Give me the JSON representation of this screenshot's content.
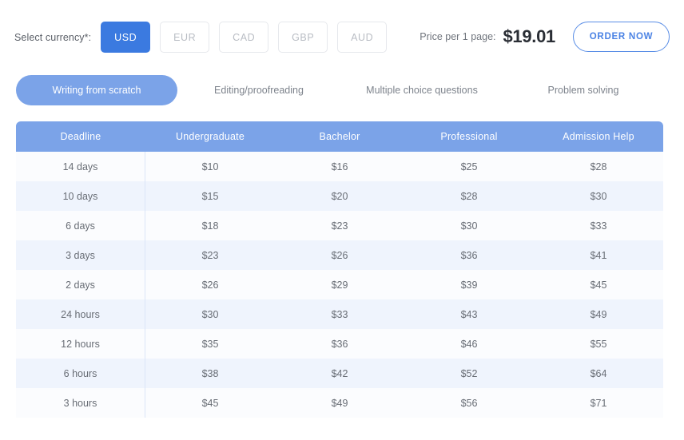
{
  "currency_selector": {
    "label": "Select currency*:",
    "options": [
      "USD",
      "EUR",
      "CAD",
      "GBP",
      "AUD"
    ],
    "selected": "USD"
  },
  "price_summary": {
    "label": "Price per 1 page:",
    "value": "$19.01",
    "order_button": "ORDER NOW"
  },
  "tabs": {
    "items": [
      "Writing from scratch",
      "Editing/proofreading",
      "Multiple choice questions",
      "Problem solving"
    ],
    "active": "Writing from scratch"
  },
  "pricing_table": {
    "columns": [
      "Deadline",
      "Undergraduate",
      "Bachelor",
      "Professional",
      "Admission Help"
    ],
    "rows": [
      [
        "14 days",
        "$10",
        "$16",
        "$25",
        "$28"
      ],
      [
        "10 days",
        "$15",
        "$20",
        "$28",
        "$30"
      ],
      [
        "6 days",
        "$18",
        "$23",
        "$30",
        "$33"
      ],
      [
        "3 days",
        "$23",
        "$26",
        "$36",
        "$41"
      ],
      [
        "2 days",
        "$26",
        "$29",
        "$39",
        "$45"
      ],
      [
        "24 hours",
        "$30",
        "$33",
        "$43",
        "$49"
      ],
      [
        "12 hours",
        "$35",
        "$36",
        "$46",
        "$55"
      ],
      [
        "6 hours",
        "$38",
        "$42",
        "$52",
        "$64"
      ],
      [
        "3 hours",
        "$45",
        "$49",
        "$56",
        "$71"
      ]
    ]
  },
  "colors": {
    "accent_strong": "#3b7ae0",
    "accent_soft": "#7ba3e8",
    "row_tint": "#eff4fd",
    "row_plain": "#fbfcfe"
  }
}
